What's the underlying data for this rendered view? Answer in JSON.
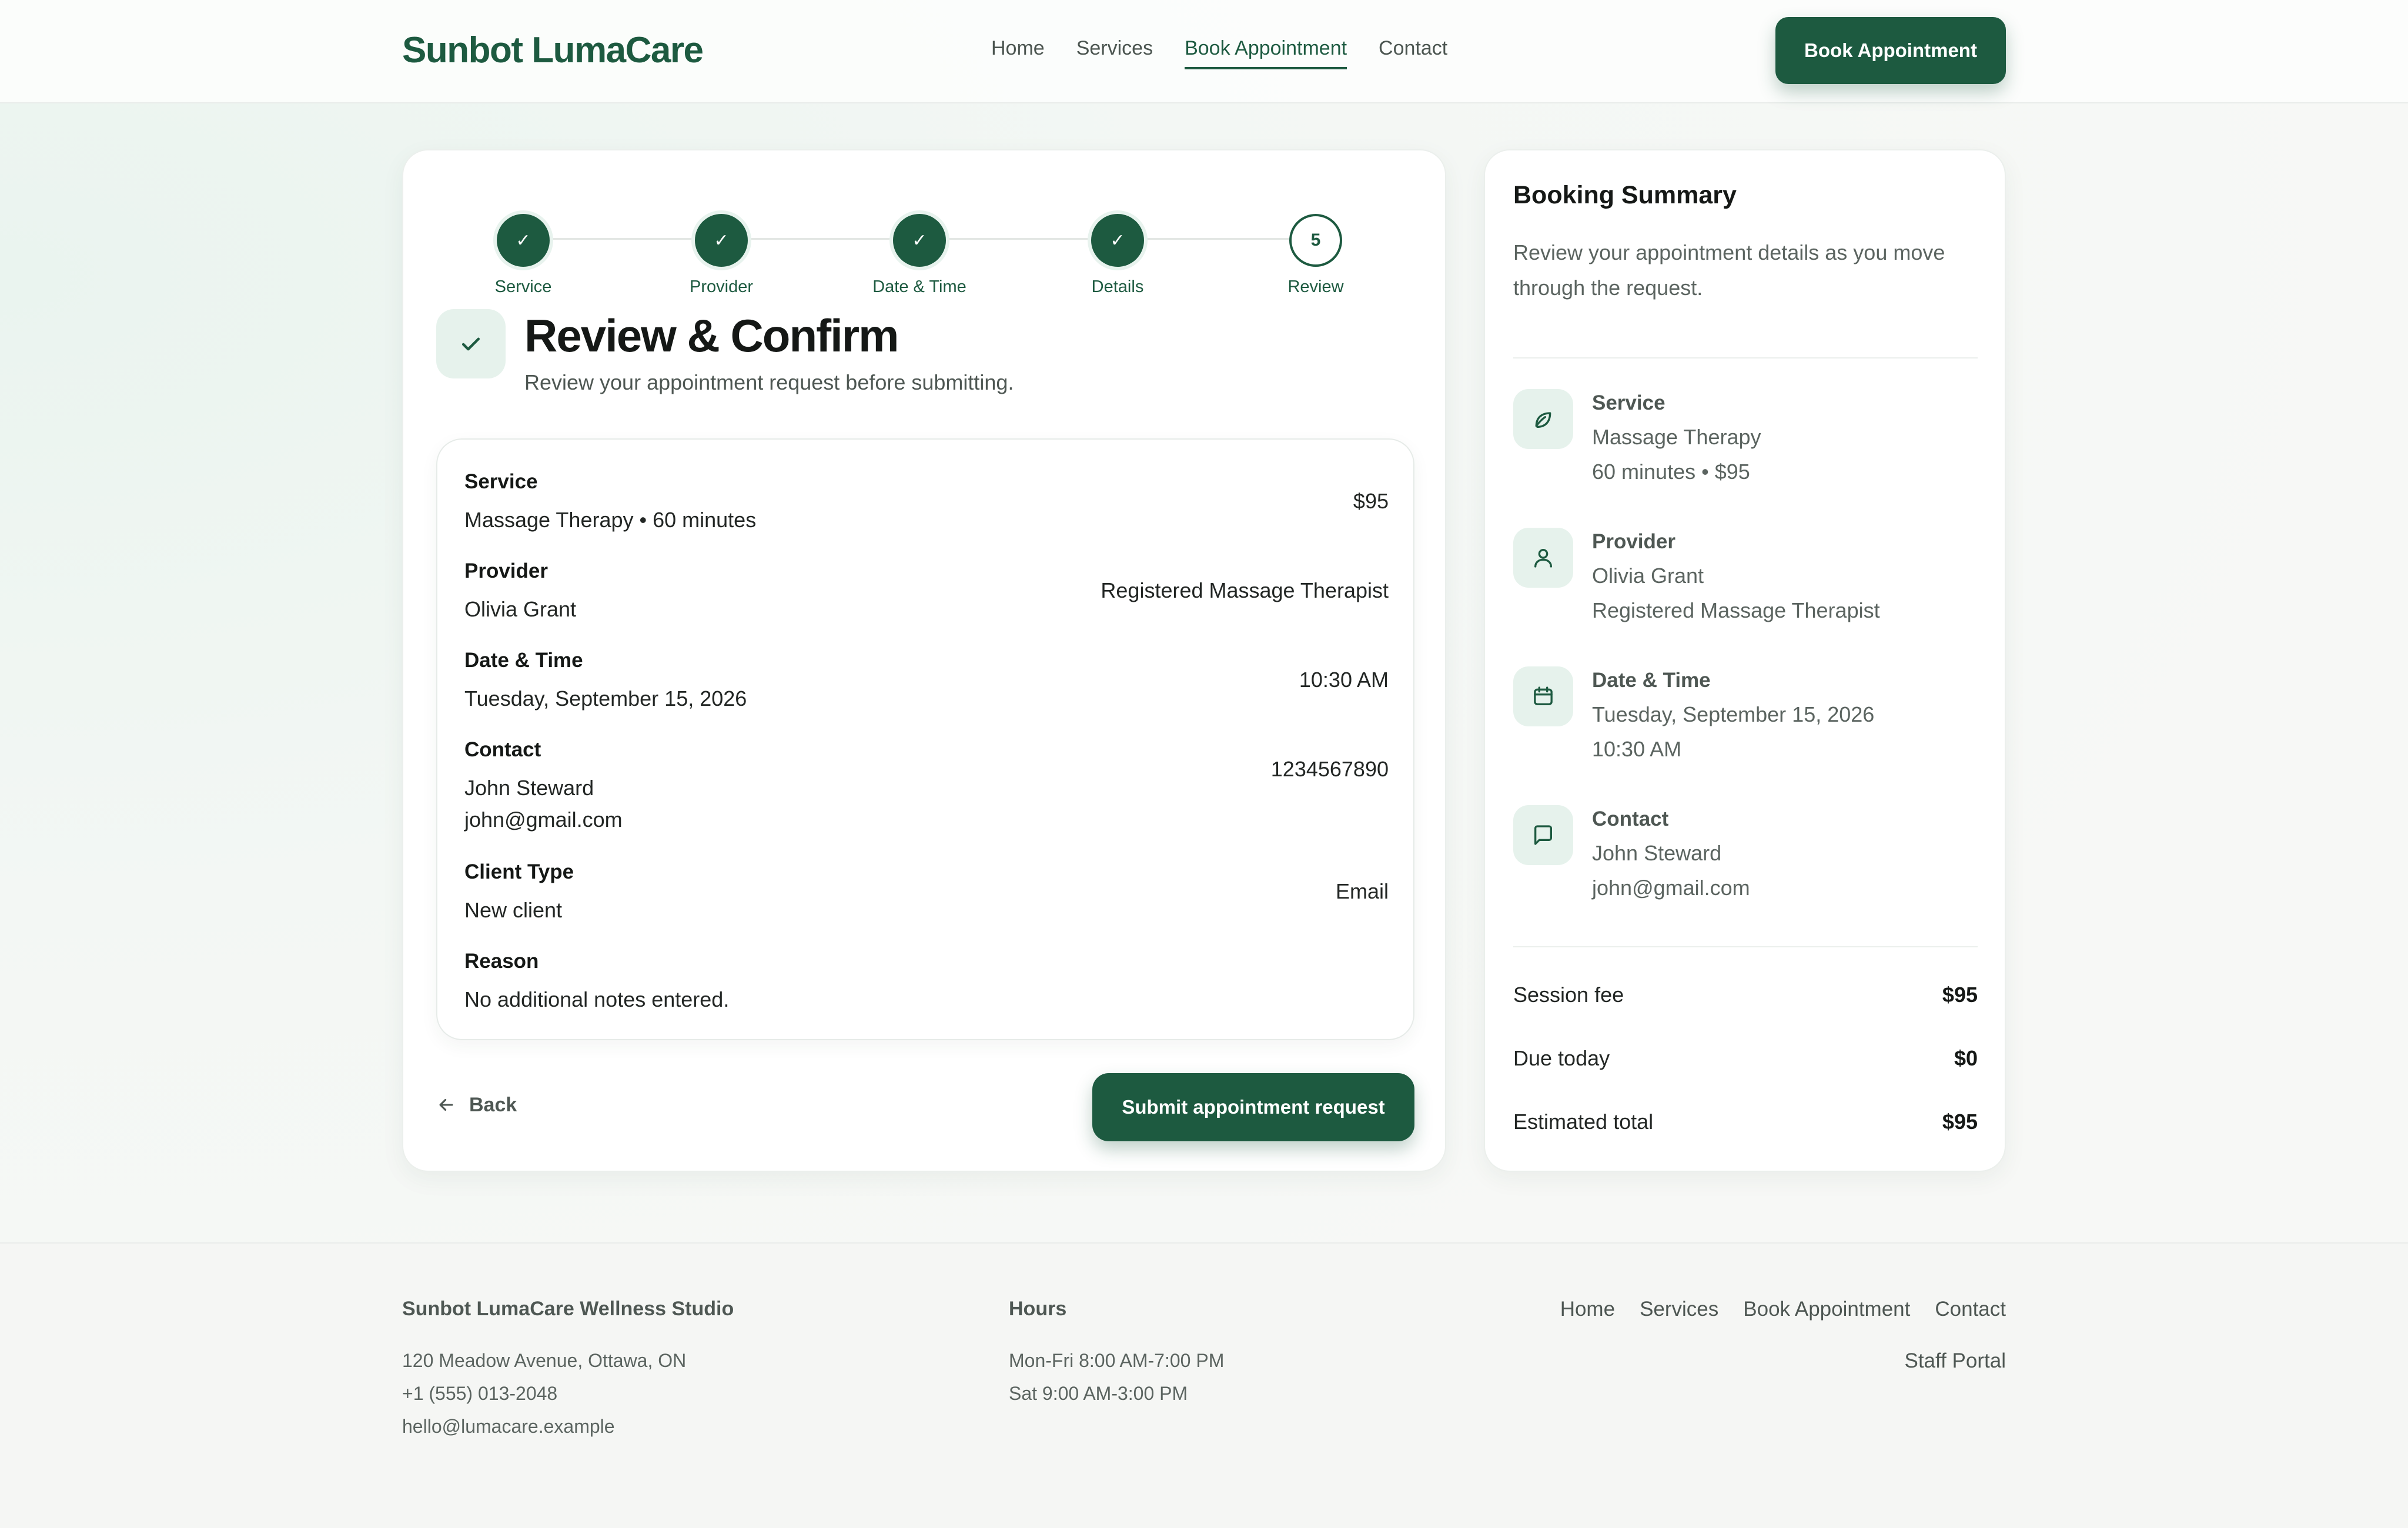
{
  "header": {
    "logo": "Sunbot LumaCare",
    "nav": [
      "Home",
      "Services",
      "Book Appointment",
      "Contact"
    ],
    "active_nav": "Book Appointment",
    "cta": "Book Appointment"
  },
  "stepper": {
    "steps": [
      {
        "label": "Service",
        "mark": "✓"
      },
      {
        "label": "Provider",
        "mark": "✓"
      },
      {
        "label": "Date & Time",
        "mark": "✓"
      },
      {
        "label": "Details",
        "mark": "✓"
      },
      {
        "label": "Review",
        "mark": "5"
      }
    ]
  },
  "review": {
    "title": "Review & Confirm",
    "subtitle": "Review your appointment request before submitting.",
    "rows": [
      {
        "label": "Service",
        "value": "Massage Therapy • 60 minutes",
        "value2": "",
        "right": "$95"
      },
      {
        "label": "Provider",
        "value": "Olivia Grant",
        "value2": "",
        "right": "Registered Massage Therapist"
      },
      {
        "label": "Date & Time",
        "value": "Tuesday, September 15, 2026",
        "value2": "",
        "right": "10:30 AM"
      },
      {
        "label": "Contact",
        "value": "John Steward",
        "value2": "john@gmail.com",
        "right": "1234567890"
      },
      {
        "label": "Client Type",
        "value": "New client",
        "value2": "",
        "right": "Email"
      },
      {
        "label": "Reason",
        "value": "No additional notes entered.",
        "value2": "",
        "right": ""
      }
    ],
    "back": "Back",
    "submit": "Submit appointment request"
  },
  "summary": {
    "title": "Booking Summary",
    "subtitle": "Review your appointment details as you move through the request.",
    "items": [
      {
        "icon": "leaf-icon",
        "label": "Service",
        "line1": "Massage Therapy",
        "line2": "60 minutes • $95"
      },
      {
        "icon": "user-icon",
        "label": "Provider",
        "line1": "Olivia Grant",
        "line2": "Registered Massage Therapist"
      },
      {
        "icon": "calendar-icon",
        "label": "Date & Time",
        "line1": "Tuesday, September 15, 2026",
        "line2": "10:30 AM"
      },
      {
        "icon": "chat-icon",
        "label": "Contact",
        "line1": "John Steward",
        "line2": "john@gmail.com"
      }
    ],
    "fees": [
      {
        "label": "Session fee",
        "value": "$95"
      },
      {
        "label": "Due today",
        "value": "$0"
      },
      {
        "label": "Estimated total",
        "value": "$95"
      }
    ]
  },
  "footer": {
    "studio": {
      "title": "Sunbot LumaCare Wellness Studio",
      "address": "120 Meadow Avenue, Ottawa, ON",
      "phone": "+1 (555) 013-2048",
      "email": "hello@lumacare.example"
    },
    "hours": {
      "title": "Hours",
      "weekday": "Mon-Fri 8:00 AM-7:00 PM",
      "saturday": "Sat 9:00 AM-3:00 PM"
    },
    "links": [
      "Home",
      "Services",
      "Book Appointment",
      "Contact"
    ],
    "staff": "Staff Portal"
  },
  "colors": {
    "brand": "#1d5a40",
    "brand_soft": "#e6f2ec",
    "background": "#f5f7f5"
  }
}
